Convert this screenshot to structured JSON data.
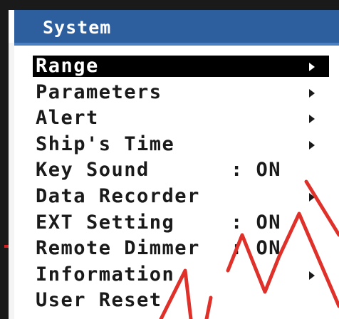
{
  "window": {
    "title": "System"
  },
  "menu": {
    "items": [
      {
        "label": "Range",
        "value": "",
        "has_submenu": true,
        "selected": true
      },
      {
        "label": "Parameters",
        "value": "",
        "has_submenu": true,
        "selected": false
      },
      {
        "label": "Alert",
        "value": "",
        "has_submenu": true,
        "selected": false
      },
      {
        "label": "Ship's Time",
        "value": "",
        "has_submenu": true,
        "selected": false
      },
      {
        "label": "Key Sound",
        "value": ": ON",
        "has_submenu": false,
        "selected": false
      },
      {
        "label": "Data Recorder",
        "value": "",
        "has_submenu": true,
        "selected": false
      },
      {
        "label": "EXT Setting",
        "value": ": ON",
        "has_submenu": false,
        "selected": false
      },
      {
        "label": "Remote Dimmer",
        "value": ": ON",
        "has_submenu": false,
        "selected": false
      },
      {
        "label": "Information",
        "value": "",
        "has_submenu": true,
        "selected": false
      },
      {
        "label": "User Reset",
        "value": "",
        "has_submenu": false,
        "selected": false
      }
    ]
  },
  "colors": {
    "title_bar": "#2d5f9f",
    "highlight": "#000000",
    "text": "#1a1a1a",
    "watermark": "#e0302a"
  }
}
